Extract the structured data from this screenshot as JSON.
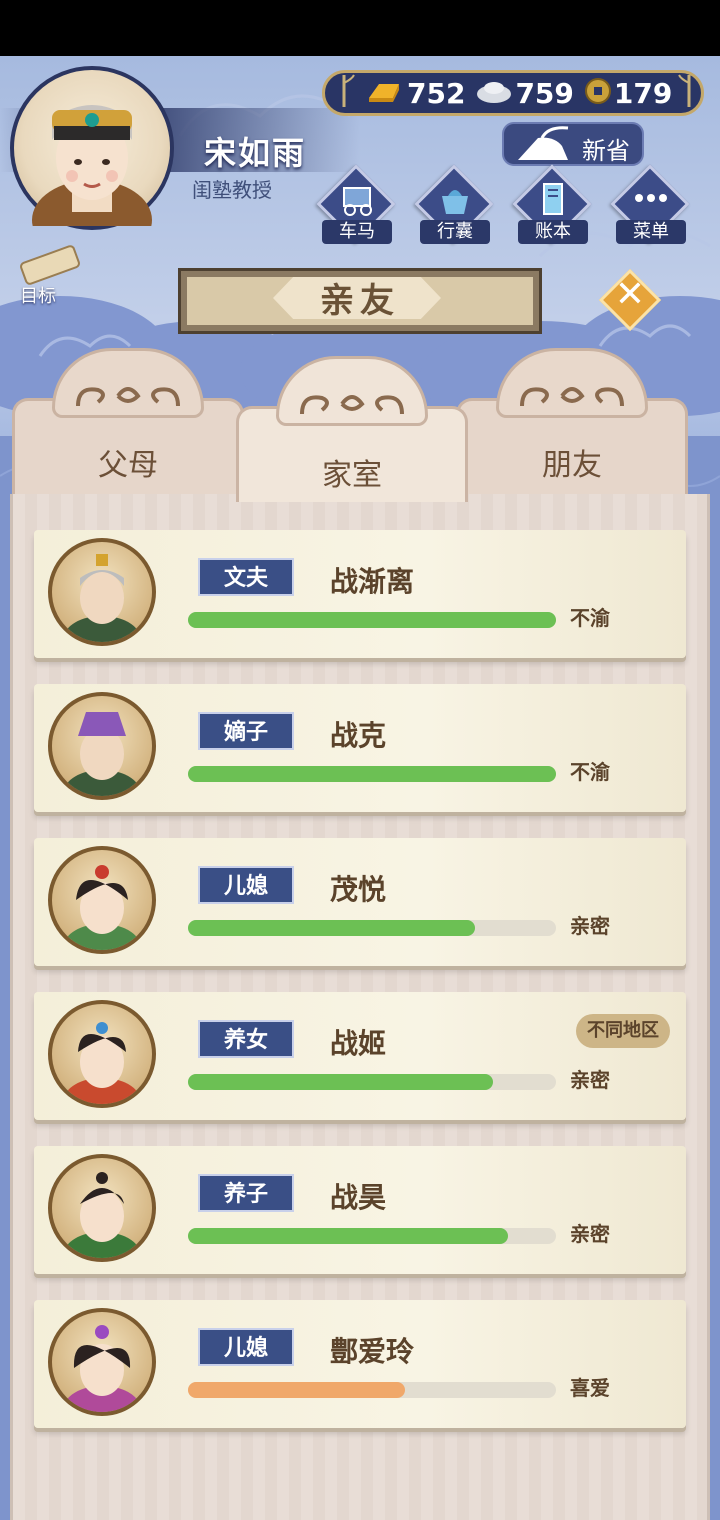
{
  "player": {
    "name": "宋如雨",
    "title": "闺塾教授",
    "avatar_icon": "noblewoman-portrait-icon"
  },
  "currency": {
    "gold": "752",
    "silver": "759",
    "coin": "179",
    "gold_icon": "gold-ingot-icon",
    "silver_icon": "silver-ingot-icon",
    "coin_icon": "copper-coin-icon"
  },
  "actions": {
    "save_label": "新省",
    "carriage_label": "车马",
    "bag_label": "行囊",
    "ledger_label": "账本",
    "menu_label": "菜单",
    "goal_label": "目标"
  },
  "banner": {
    "title": "亲友"
  },
  "tabs": [
    {
      "label": "父母",
      "active": false
    },
    {
      "label": "家室",
      "active": true
    },
    {
      "label": "朋友",
      "active": false
    }
  ],
  "relations": [
    {
      "role": "文夫",
      "name": "战渐离",
      "status": "不渝",
      "affinity": 1.0,
      "bar_color": "#6cc054",
      "region": ""
    },
    {
      "role": "嫡子",
      "name": "战克",
      "status": "不渝",
      "affinity": 1.0,
      "bar_color": "#6cc054",
      "region": ""
    },
    {
      "role": "儿媳",
      "name": "茂悦",
      "status": "亲密",
      "affinity": 0.78,
      "bar_color": "#6cc054",
      "region": ""
    },
    {
      "role": "养女",
      "name": "战姬",
      "status": "亲密",
      "affinity": 0.83,
      "bar_color": "#6cc054",
      "region": "不同地区"
    },
    {
      "role": "养子",
      "name": "战昊",
      "status": "亲密",
      "affinity": 0.87,
      "bar_color": "#6cc054",
      "region": ""
    },
    {
      "role": "儿媳",
      "name": "鄷爱玲",
      "status": "喜爱",
      "affinity": 0.59,
      "bar_color": "#f0a86a",
      "region": ""
    }
  ]
}
